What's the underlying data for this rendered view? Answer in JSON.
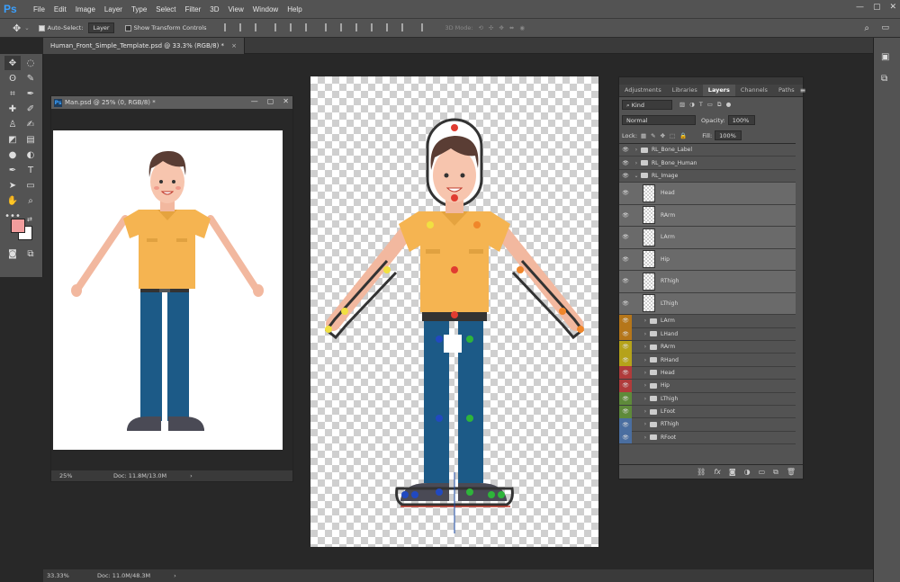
{
  "app": {
    "logo": "Ps",
    "menu": [
      "File",
      "Edit",
      "Image",
      "Layer",
      "Type",
      "Select",
      "Filter",
      "3D",
      "View",
      "Window",
      "Help"
    ],
    "window_controls": [
      "—",
      "▢",
      "✕"
    ]
  },
  "options": {
    "auto_select_label": "Auto-Select:",
    "auto_select_value": "Layer",
    "transform_label": "Show Transform Controls",
    "mode_3d": "3D Mode:"
  },
  "doc_tab": {
    "title": "Human_Front_Simple_Template.psd @ 33.3% (RGB/8) *",
    "close": "×"
  },
  "man_window": {
    "title": "Man.psd @ 25% (0, RGB/8) *",
    "zoom": "25%",
    "doc_info": "Doc: 11.8M/13.0M",
    "controls": [
      "—",
      "▢",
      "✕"
    ]
  },
  "status": {
    "zoom": "33.33%",
    "doc_info": "Doc: 11.0M/48.3M"
  },
  "colors": {
    "foreground": "#f29d9d",
    "background": "#ffffff"
  },
  "layers_panel": {
    "tabs": [
      "Adjustments",
      "Libraries",
      "Layers",
      "Channels",
      "Paths"
    ],
    "active_tab": "Layers",
    "filter": "Kind",
    "blend_mode": "Normal",
    "opacity_label": "Opacity:",
    "opacity_value": "100%",
    "lock_label": "Lock:",
    "fill_label": "Fill:",
    "fill_value": "100%",
    "layers": [
      {
        "name": "RL_Bone_Label",
        "kind": "group",
        "indent": 0,
        "color": ""
      },
      {
        "name": "RL_Bone_Human",
        "kind": "group",
        "indent": 0,
        "color": ""
      },
      {
        "name": "RL_Image",
        "kind": "group-open",
        "indent": 0,
        "color": ""
      },
      {
        "name": "Head",
        "kind": "image",
        "indent": 1,
        "color": ""
      },
      {
        "name": "RArm",
        "kind": "image",
        "indent": 1,
        "color": ""
      },
      {
        "name": "LArm",
        "kind": "image",
        "indent": 1,
        "color": ""
      },
      {
        "name": "Hip",
        "kind": "image",
        "indent": 1,
        "color": ""
      },
      {
        "name": "RThigh",
        "kind": "image",
        "indent": 1,
        "color": ""
      },
      {
        "name": "LThigh",
        "kind": "image",
        "indent": 1,
        "color": ""
      },
      {
        "name": "LArm",
        "kind": "group",
        "indent": 1,
        "color": "#b5761a"
      },
      {
        "name": "LHand",
        "kind": "group",
        "indent": 1,
        "color": "#b5761a"
      },
      {
        "name": "RArm",
        "kind": "group",
        "indent": 1,
        "color": "#b5a21a"
      },
      {
        "name": "RHand",
        "kind": "group",
        "indent": 1,
        "color": "#b5a21a"
      },
      {
        "name": "Head",
        "kind": "group",
        "indent": 1,
        "color": "#b03b3b"
      },
      {
        "name": "Hip",
        "kind": "group",
        "indent": 1,
        "color": "#b03b3b"
      },
      {
        "name": "LThigh",
        "kind": "group",
        "indent": 1,
        "color": "#5e8a3a"
      },
      {
        "name": "LFoot",
        "kind": "group",
        "indent": 1,
        "color": "#5e8a3a"
      },
      {
        "name": "RThigh",
        "kind": "group",
        "indent": 1,
        "color": "#4a6ea0"
      },
      {
        "name": "RFoot",
        "kind": "group",
        "indent": 1,
        "color": "#4a6ea0"
      }
    ],
    "footer_icons": [
      "link-icon",
      "fx-icon",
      "mask-icon",
      "adjustment-icon",
      "group-icon",
      "new-layer-icon",
      "trash-icon"
    ]
  }
}
